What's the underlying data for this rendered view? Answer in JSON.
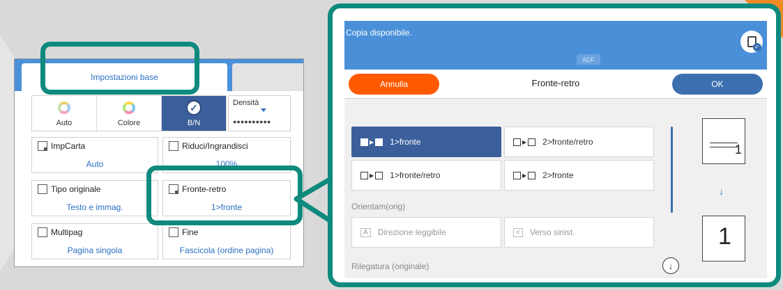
{
  "left_panel": {
    "tab_active": "Impostazioni base",
    "color_modes": [
      {
        "label": "Auto",
        "selected": false
      },
      {
        "label": "Colore",
        "selected": false
      },
      {
        "label": "B/N",
        "selected": true
      }
    ],
    "density": {
      "label": "Densità"
    },
    "options": {
      "imp_carta": {
        "title": "ImpCarta",
        "value": "Auto"
      },
      "riduci": {
        "title": "Riduci/Ingrandisci",
        "value": "100%"
      },
      "tipo_originale": {
        "title": "Tipo originale",
        "value": "Testo e immag."
      },
      "fronte_retro": {
        "title": "Fronte-retro",
        "value": "1>fronte"
      },
      "multipag": {
        "title": "Multipag",
        "value": "Pagina singola"
      },
      "fine": {
        "title": "Fine",
        "value": "Fascicola (ordine pagina)"
      }
    }
  },
  "right_panel": {
    "status": "Copia disponibile.",
    "adf": "ADF",
    "title": "Fronte-retro",
    "cancel_label": "Annulla",
    "ok_label": "OK",
    "choices": [
      {
        "label": "1>fronte",
        "selected": true
      },
      {
        "label": "2>fronte/retro",
        "selected": false
      },
      {
        "label": "1>fronte/retro",
        "selected": false
      },
      {
        "label": "2>fronte",
        "selected": false
      }
    ],
    "orientation_label": "Orientam(orig)",
    "orientation_options": [
      {
        "label": "Direzione leggibile",
        "icon": "A"
      },
      {
        "label": "Verso sinist.",
        "icon": "<"
      }
    ],
    "binding_label": "Rilegatura (originale)",
    "preview_top_number": "1",
    "preview_bottom_number": "1"
  },
  "colors": {
    "accent_teal": "#0e8a7e",
    "header_blue": "#4a90d9",
    "cancel_orange": "#ff5a00",
    "ok_blue": "#3b6fb0"
  }
}
